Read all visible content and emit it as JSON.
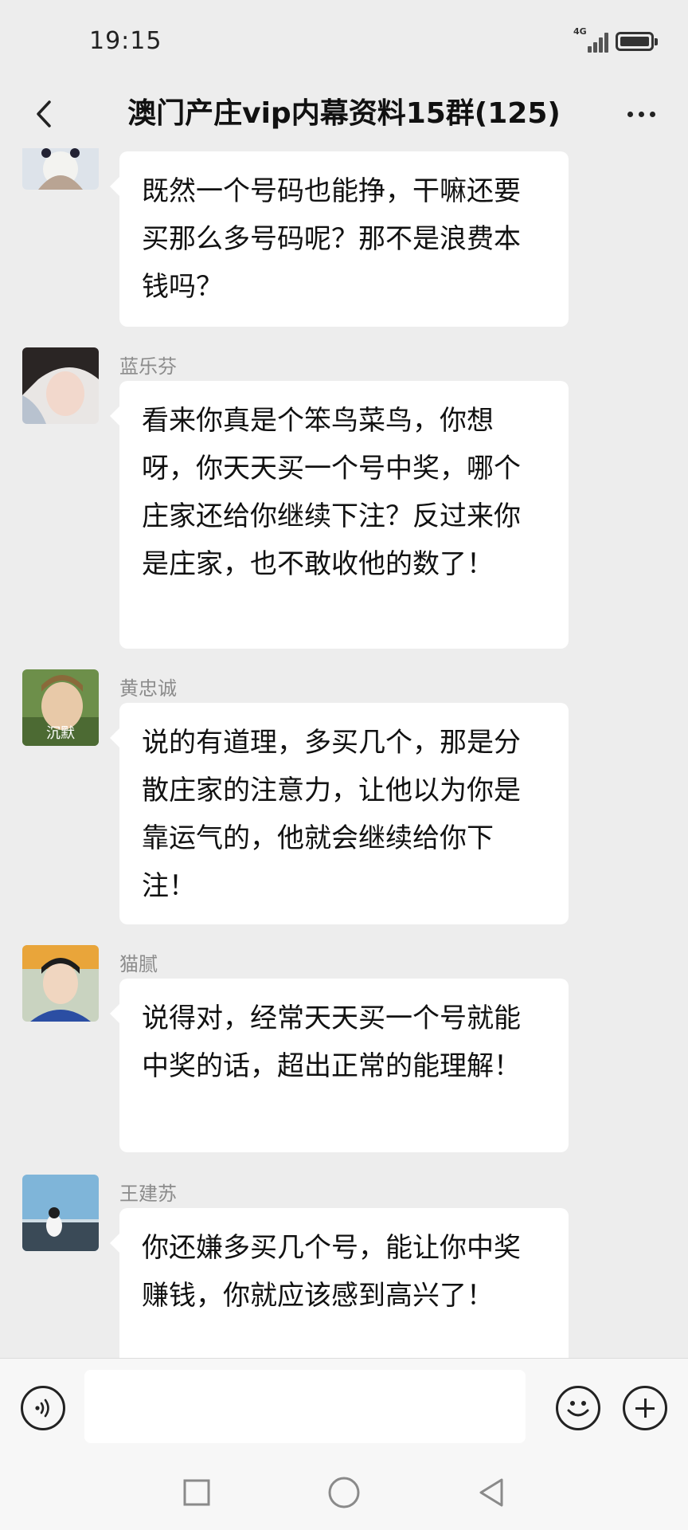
{
  "status_bar": {
    "time": "19:15",
    "network_label": "4G"
  },
  "header": {
    "title": "澳门产庄vip内幕资料15群(125)",
    "back_icon": "chevron-left-icon",
    "more_icon": "more-dots-icon"
  },
  "messages": [
    {
      "sender": "",
      "text": "既然一个号码也能挣，干嘛还要买那么多号码呢？那不是浪费本钱吗？"
    },
    {
      "sender": "蓝乐芬",
      "text": "看来你真是个笨鸟菜鸟，你想呀，你天天买一个号中奖，哪个庄家还给你继续下注？反过来你是庄家，也不敢收他的数了！"
    },
    {
      "sender": "黄忠诚",
      "avatar_caption": "沉默",
      "text": "说的有道理，多买几个，那是分散庄家的注意力，让他以为你是靠运气的，他就会继续给你下注！"
    },
    {
      "sender": "猫腻",
      "text": "说得对，经常天天买一个号就能中奖的话，超出正常的能理解！"
    },
    {
      "sender": "王建苏",
      "text": "你还嫌多买几个号，能让你中奖赚钱，你就应该感到高兴了！"
    }
  ],
  "input_bar": {
    "voice_icon": "voice-icon",
    "text_value": "",
    "emoji_icon": "emoji-icon",
    "plus_icon": "plus-icon"
  },
  "nav_bar": {
    "icons": [
      "square-icon",
      "circle-icon",
      "triangle-back-icon"
    ]
  }
}
